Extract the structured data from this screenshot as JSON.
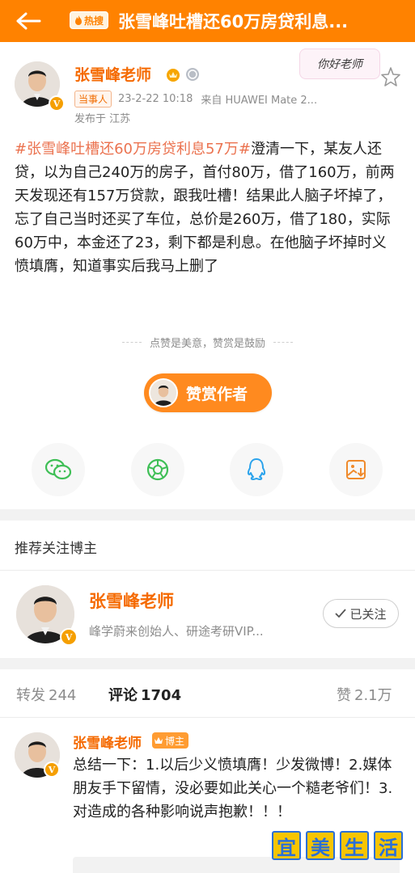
{
  "header": {
    "hot_label": "热搜",
    "title": "张雪峰吐槽还60万房贷利息..."
  },
  "post": {
    "author": "张雪峰老师",
    "party_tag": "当事人",
    "time": "23-2-22 10:18",
    "source": "来自 HUAWEI Mate 2...",
    "location": "发布于 江苏",
    "sticker_text": "你好老师",
    "topic": "#张雪峰吐槽还60万房贷利息57万#",
    "body": "澄清一下，某友人还贷，以为自己240万的房子，首付80万，借了160万，前两天发现还有157万贷款，跟我吐槽！结果此人脑子坏掉了，忘了自己当时还买了车位，总价是260万，借了180，实际60万中，本金还了23，剩下都是利息。在他脑子坏掉时义愤填膺，知道事实后我马上删了",
    "reward_tip": "点赞是美意，赞赏是鼓励",
    "reward_button": "赞赏作者",
    "share_icons": [
      "wechat-icon",
      "moments-icon",
      "qq-icon",
      "save-image-icon"
    ]
  },
  "recommend": {
    "section_title": "推荐关注博主",
    "name": "张雪峰老师",
    "desc": "峰学蔚来创始人、研途考研VIP...",
    "follow_label": "已关注"
  },
  "tabs": {
    "repost_label": "转发",
    "repost_count": "244",
    "comment_label": "评论",
    "comment_count": "1704",
    "like_label": "赞",
    "like_count": "2.1万"
  },
  "comment": {
    "author": "张雪峰老师",
    "tag": "博主",
    "text": "总结一下：1.以后少义愤填膺！少发微博！2.媒体朋友手下留情，没必要如此关心一个糙老爷们！3.对造成的各种影响说声抱歉！！！"
  },
  "watermark": {
    "chars": [
      "宜",
      "美",
      "生",
      "活"
    ]
  },
  "colors": {
    "header_bg": "#ff8200",
    "name_orange": "#f56a00",
    "topic_color": "#eb7350",
    "reward_bg": "#ff8a1f"
  }
}
